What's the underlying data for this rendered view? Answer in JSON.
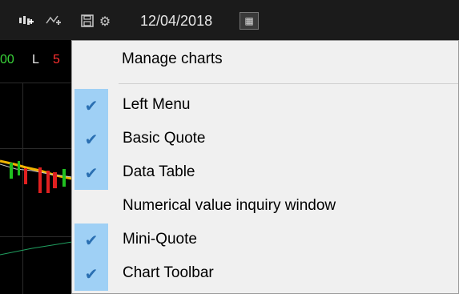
{
  "toolbar": {
    "icons": [
      "crosshair-add-icon",
      "chart-compare-icon",
      "save-icon",
      "gear-icon",
      "calendar-icon"
    ],
    "date": "12/04/2018"
  },
  "quote": {
    "v1": "00",
    "v2": "L",
    "v3": "5"
  },
  "menu": {
    "header": "Manage charts",
    "items": [
      {
        "label": "Left Menu",
        "checked": true
      },
      {
        "label": "Basic Quote",
        "checked": true
      },
      {
        "label": "Data Table",
        "checked": true
      },
      {
        "label": "Numerical value inquiry window",
        "checked": false
      },
      {
        "label": "Mini-Quote",
        "checked": true
      },
      {
        "label": "Chart Toolbar",
        "checked": true
      }
    ]
  },
  "colors": {
    "menu_bg": "#f0f0f0",
    "check_bg": "#9fd0f5",
    "toolbar_bg": "#1b1b1b",
    "quote_green": "#39d339",
    "quote_red": "#ff3030"
  }
}
